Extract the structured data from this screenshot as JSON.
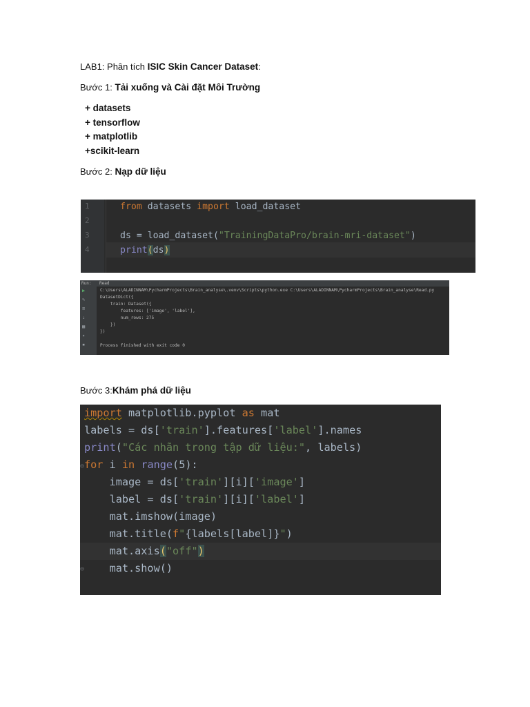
{
  "heading": {
    "prefix": "LAB1: Phân tích ",
    "bold": "ISIC Skin Cancer Dataset",
    "suffix": ":"
  },
  "step1": {
    "prefix": "Bước 1: ",
    "bold": "Tải xuống và Cài đặt Môi Trường"
  },
  "packages": [
    "+ datasets",
    "+ tensorflow",
    "+ matplotlib",
    "+scikit-learn"
  ],
  "step2": {
    "prefix": "Bước 2:  ",
    "bold": "Nạp dữ liệu"
  },
  "code1": {
    "line_numbers": [
      "1",
      "2",
      "3",
      "4"
    ],
    "line1": {
      "kw1": "from",
      "mid": " datasets ",
      "kw2": "import",
      "tail": " load_dataset"
    },
    "line3": {
      "head": "ds = load_dataset(",
      "str": "\"TrainingDataPro/brain-mri-dataset\"",
      "tail": ")"
    },
    "line4": {
      "fn": "print",
      "open": "(",
      "arg": "ds",
      "close": ")"
    }
  },
  "console": {
    "tab_run": "Run:",
    "tab_name": "Read",
    "lines": [
      "C:\\Users\\ALADINNAM\\PycharmProjects\\Brain_analyse\\.venv\\Scripts\\python.exe C:\\Users\\ALADINNAM\\PycharmProjects\\Brain_analyse\\Read.py",
      "DatasetDict({",
      "    train: Dataset({",
      "        features: ['image', 'label'],",
      "        num_rows: 275",
      "    })",
      "})",
      "",
      "Process finished with exit code 0"
    ]
  },
  "step3": {
    "prefix": "Bước 3:",
    "bold": "Khám phá dữ liệu"
  },
  "code2": {
    "l1": {
      "kw": "import",
      "mid": " matplotlib.pyplot ",
      "kw2": "as",
      "tail": " mat"
    },
    "l2": {
      "a": "labels = ds[",
      "s1": "'train'",
      "b": "].features[",
      "s2": "'label'",
      "c": "].names"
    },
    "l3": {
      "fn": "print",
      "a": "(",
      "s": "\"Các nhãn trong tập dữ liệu:\"",
      "b": ", labels)"
    },
    "l4": {
      "kw": "for",
      "a": " i ",
      "kw2": "in",
      "sp": " ",
      "fn": "range",
      "b": "(5):"
    },
    "l5": {
      "a": "    image = ds[",
      "s1": "'train'",
      "b": "][i][",
      "s2": "'image'",
      "c": "]"
    },
    "l6": {
      "a": "    label = ds[",
      "s1": "'train'",
      "b": "][i][",
      "s2": "'label'",
      "c": "]"
    },
    "l7": {
      "a": "    mat.imshow(image)"
    },
    "l8": {
      "a": "    mat.title(",
      "f": "f",
      "s1": "\"",
      "b": "{labels[label]}",
      "s2": "\"",
      "c": ")"
    },
    "l9": {
      "a": "    mat.axis",
      "open": "(",
      "s": "\"off\"",
      "close": ")"
    },
    "l10": {
      "a": "    mat.show()"
    }
  }
}
